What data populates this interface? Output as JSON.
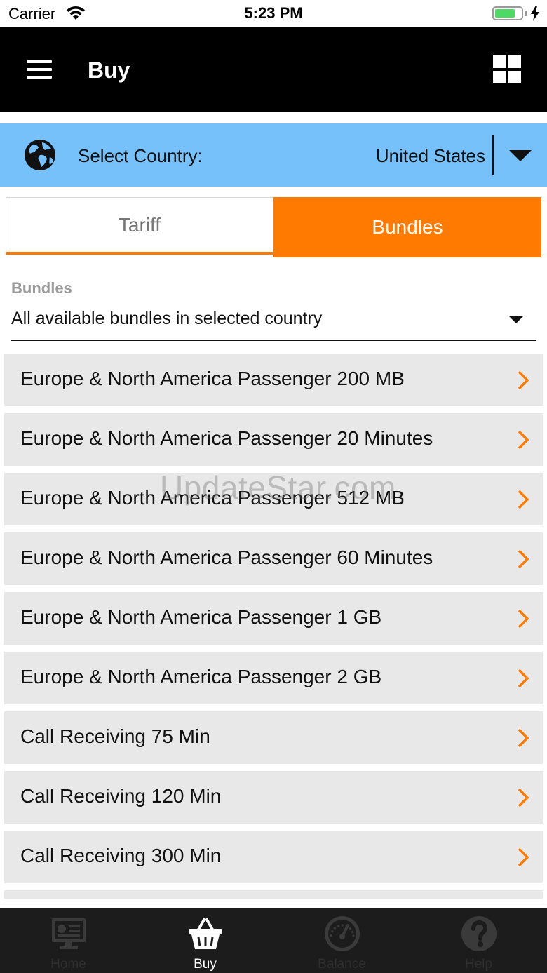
{
  "status_bar": {
    "carrier": "Carrier",
    "time": "5:23 PM",
    "wifi_icon": "wifi-icon",
    "battery_icon": "battery-charging-icon"
  },
  "navbar": {
    "title": "Buy",
    "menu_icon": "hamburger-menu-icon",
    "grid_icon": "grid-view-icon"
  },
  "country": {
    "label": "Select Country:",
    "value": "United States",
    "icon": "globe-icon"
  },
  "tabs": {
    "tariff": "Tariff",
    "bundles": "Bundles",
    "active": "bundles"
  },
  "bundle_filter": {
    "label": "Bundles",
    "value": "All available bundles in selected country"
  },
  "bundles": [
    "Europe & North America Passenger 200 MB",
    "Europe & North America Passenger 20 Minutes",
    "Europe & North America Passenger 512 MB",
    "Europe & North America Passenger 60 Minutes",
    "Europe & North America Passenger 1 GB",
    "Europe & North America Passenger 2 GB",
    "Call Receiving 75 Min",
    "Call Receiving 120 Min",
    "Call Receiving 300 Min"
  ],
  "watermark": "UpdateStar.com",
  "tabbar": {
    "items": [
      {
        "label": "Home",
        "icon": "monitor-icon",
        "active": false
      },
      {
        "label": "Buy",
        "icon": "basket-icon",
        "active": true
      },
      {
        "label": "Balance",
        "icon": "gauge-icon",
        "active": false
      },
      {
        "label": "Help",
        "icon": "help-icon",
        "active": false
      }
    ]
  },
  "colors": {
    "accent": "#ff7a00",
    "country_bar": "#77c1fb",
    "navbar": "#000000",
    "list_item": "#e8e8e8",
    "tabbar": "#1c1c1c"
  }
}
